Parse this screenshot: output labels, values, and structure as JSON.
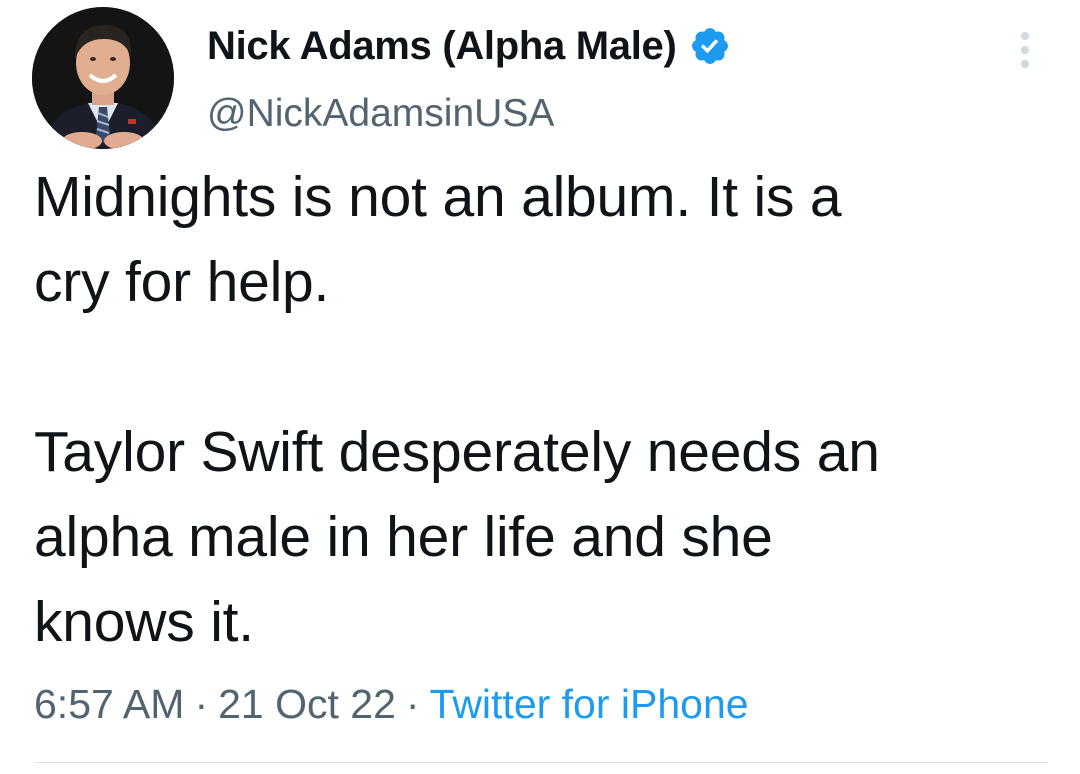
{
  "tweet": {
    "author_name": "Nick Adams (Alpha Male)",
    "handle": "@NickAdamsinUSA",
    "verified": true,
    "text": "Midnights is not an album. It is a\ncry for help.\n\nTaylor Swift desperately needs an\nalpha male in her life and she\nknows it.",
    "time": "6:57 AM",
    "date": "21 Oct 22",
    "separator": "·",
    "source": "Twitter for iPhone"
  },
  "icons": {
    "verified": "verified-badge-icon",
    "more": "more-options-icon"
  },
  "colors": {
    "text": "#0f1419",
    "secondary_text": "#536471",
    "link": "#1d9bf0",
    "verified_badge": "#1d9bf0",
    "divider": "#dfe3e6",
    "background": "#ffffff"
  }
}
